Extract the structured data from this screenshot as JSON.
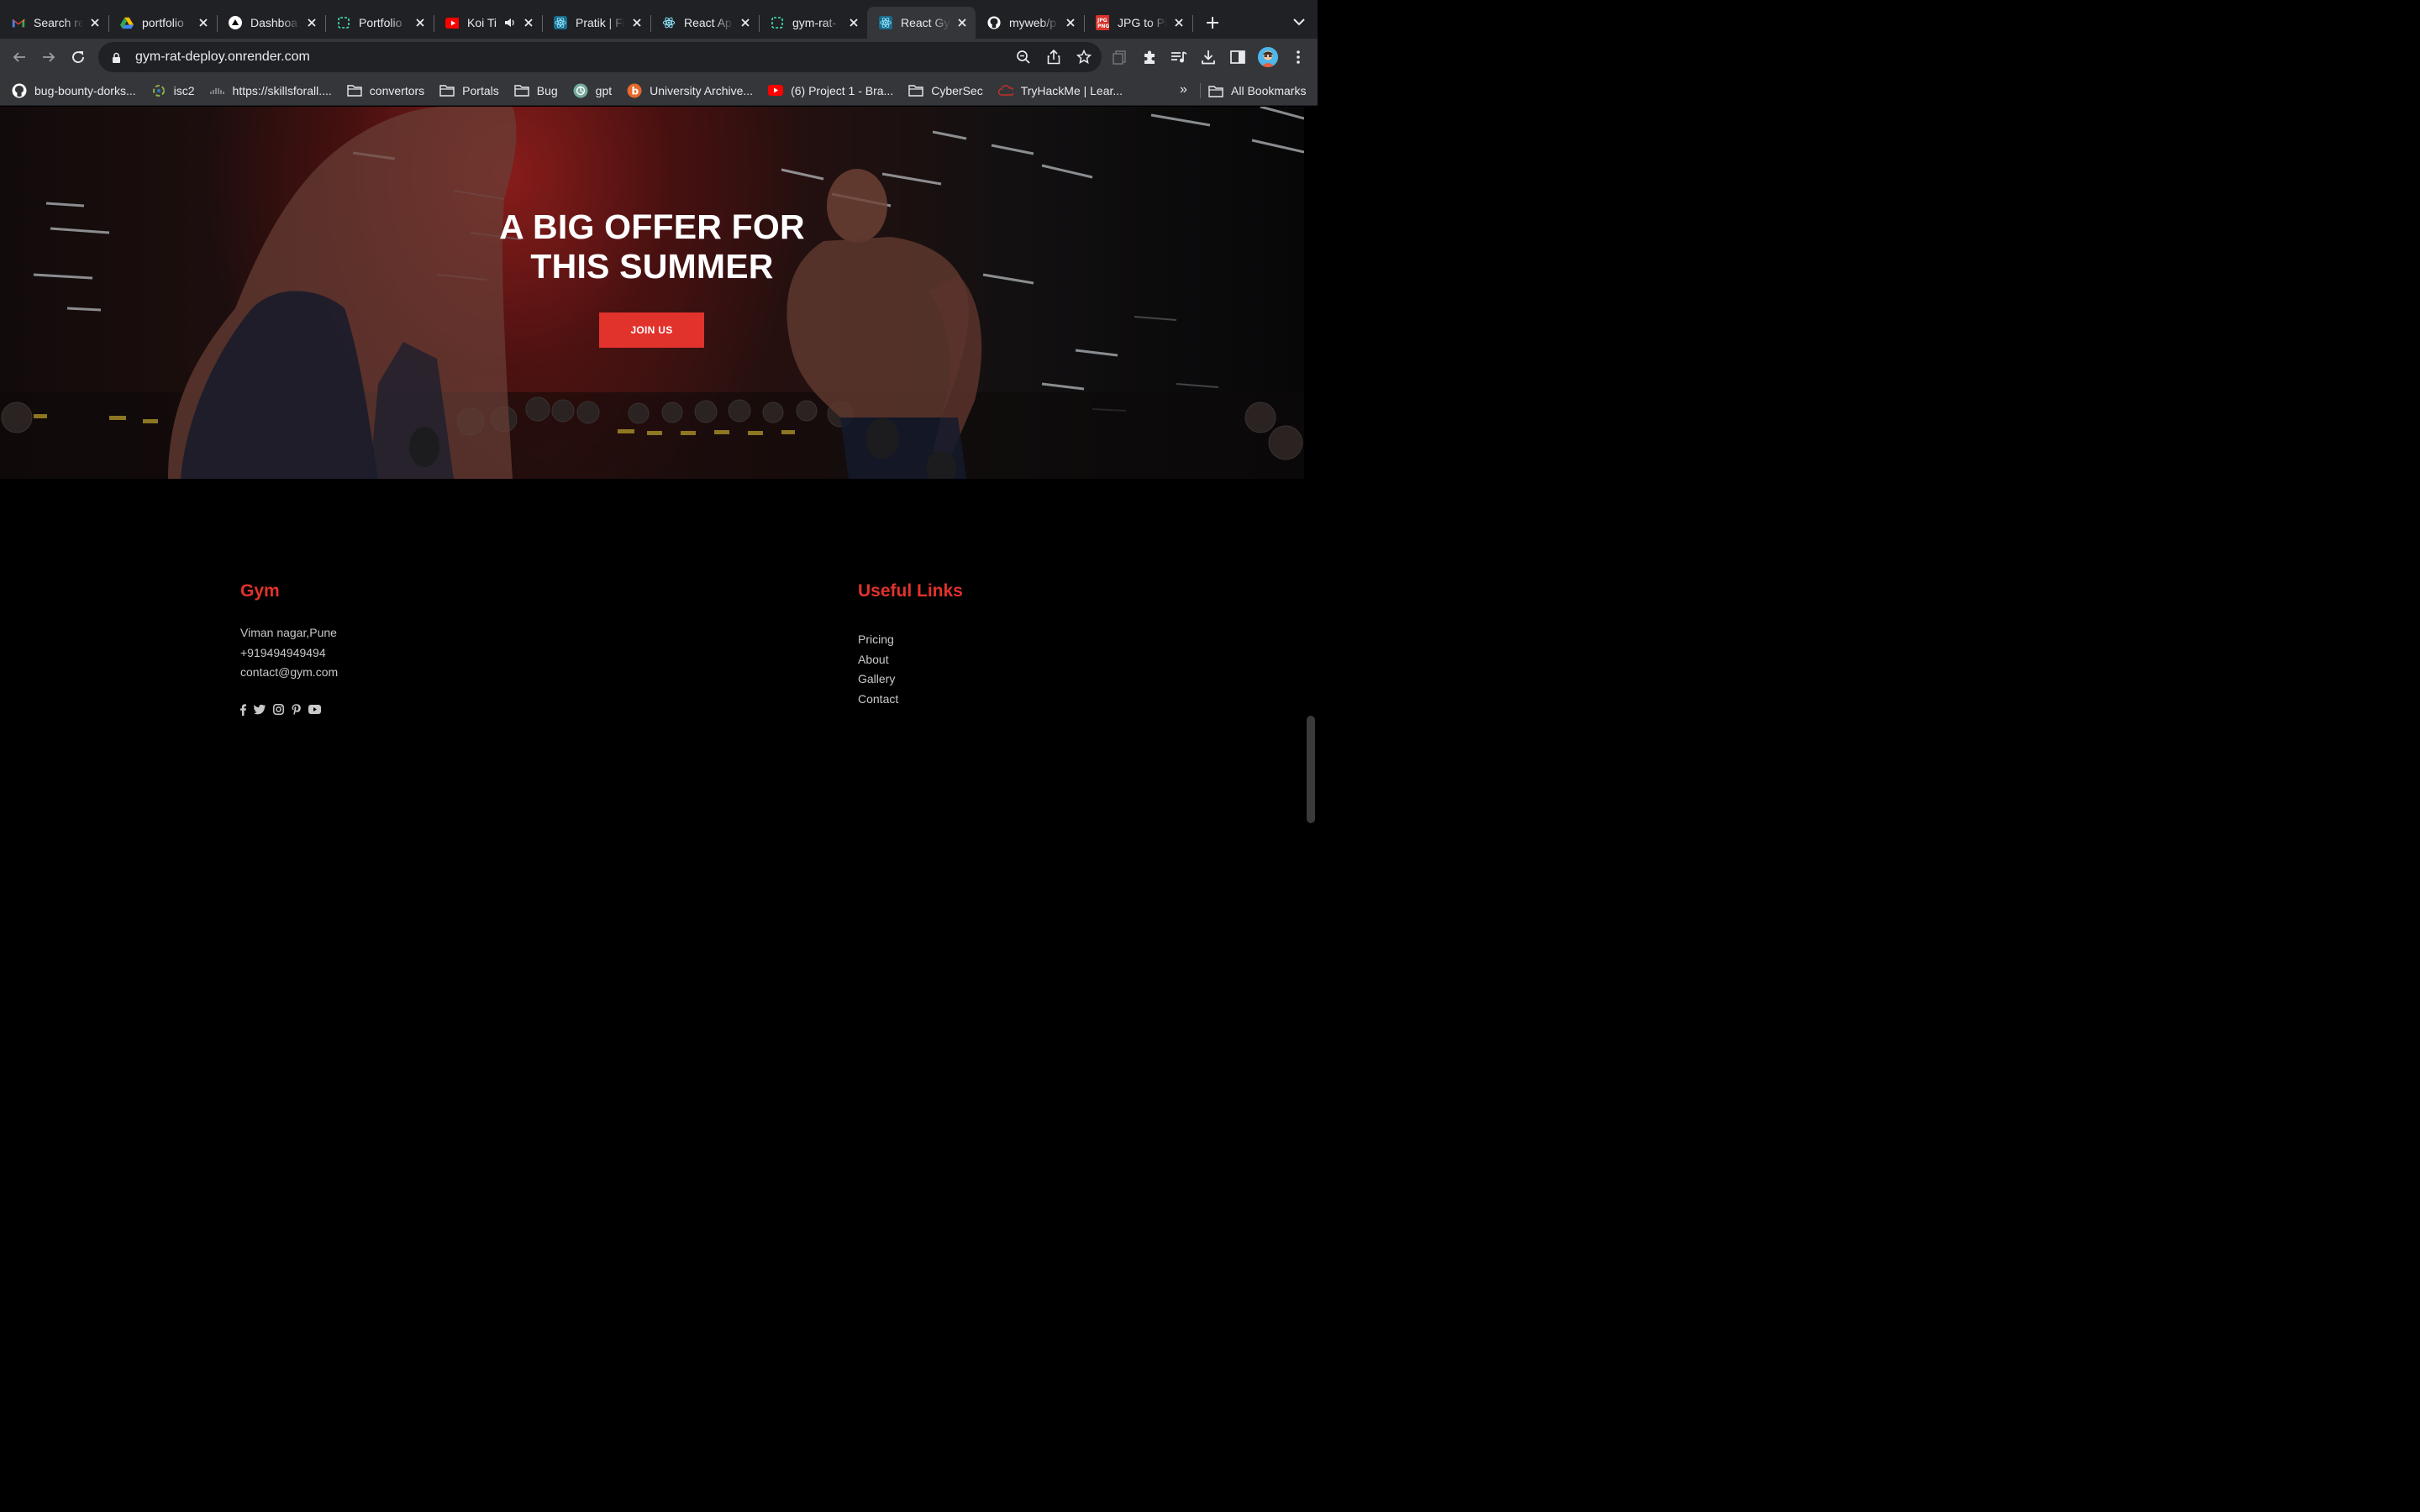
{
  "browser": {
    "tabs": [
      {
        "title": "Search re",
        "favicon": "gmail-icon",
        "active": false
      },
      {
        "title": "portfolio",
        "favicon": "google-drive-icon",
        "active": false
      },
      {
        "title": "Dashboa",
        "favicon": "vercel-icon",
        "active": false
      },
      {
        "title": "Portfolio",
        "favicon": "render-icon",
        "active": false
      },
      {
        "title": "Koi Ti",
        "favicon": "youtube-icon",
        "active": false,
        "audio": true
      },
      {
        "title": "Pratik | Fi",
        "favicon": "react-icon",
        "active": false
      },
      {
        "title": "React Ap",
        "favicon": "react-icon",
        "active": false
      },
      {
        "title": "gym-rat-",
        "favicon": "render-icon",
        "active": false
      },
      {
        "title": "React Gy",
        "favicon": "react-icon",
        "active": true
      },
      {
        "title": "myweb/p",
        "favicon": "github-icon",
        "active": false
      },
      {
        "title": "JPG to Pi",
        "favicon": "jpg-png-icon",
        "active": false
      }
    ],
    "url": "gym-rat-deploy.onrender.com",
    "bookmarks": [
      {
        "label": "bug-bounty-dorks...",
        "icon": "github-icon"
      },
      {
        "label": "isc2",
        "icon": "isc2-icon"
      },
      {
        "label": "https://skillsforall....",
        "icon": "cisco-icon"
      },
      {
        "label": "convertors",
        "icon": "folder-icon"
      },
      {
        "label": "Portals",
        "icon": "folder-icon"
      },
      {
        "label": "Bug",
        "icon": "folder-icon"
      },
      {
        "label": "gpt",
        "icon": "chatgpt-icon"
      },
      {
        "label": "University Archive...",
        "icon": "b-icon"
      },
      {
        "label": "(6) Project 1 - Bra...",
        "icon": "youtube-icon"
      },
      {
        "label": "CyberSec",
        "icon": "folder-icon"
      },
      {
        "label": "TryHackMe | Lear...",
        "icon": "tryhackme-icon"
      }
    ],
    "bookmarks_more": "»",
    "all_bookmarks": "All Bookmarks"
  },
  "hero": {
    "title_line1": "A BIG OFFER FOR",
    "title_line2": "THIS SUMMER",
    "cta_label": "JOIN US",
    "accent": "#e1322c"
  },
  "footer": {
    "brand": {
      "heading": "Gym",
      "address": "Viman nagar,Pune",
      "phone": "+919494949494",
      "email": "contact@gym.com",
      "socials": [
        "facebook-icon",
        "twitter-icon",
        "instagram-icon",
        "pinterest-icon",
        "youtube-icon"
      ]
    },
    "useful_links": {
      "heading": "Useful Links",
      "links": [
        "Pricing",
        "About",
        "Gallery",
        "Contact"
      ]
    }
  }
}
